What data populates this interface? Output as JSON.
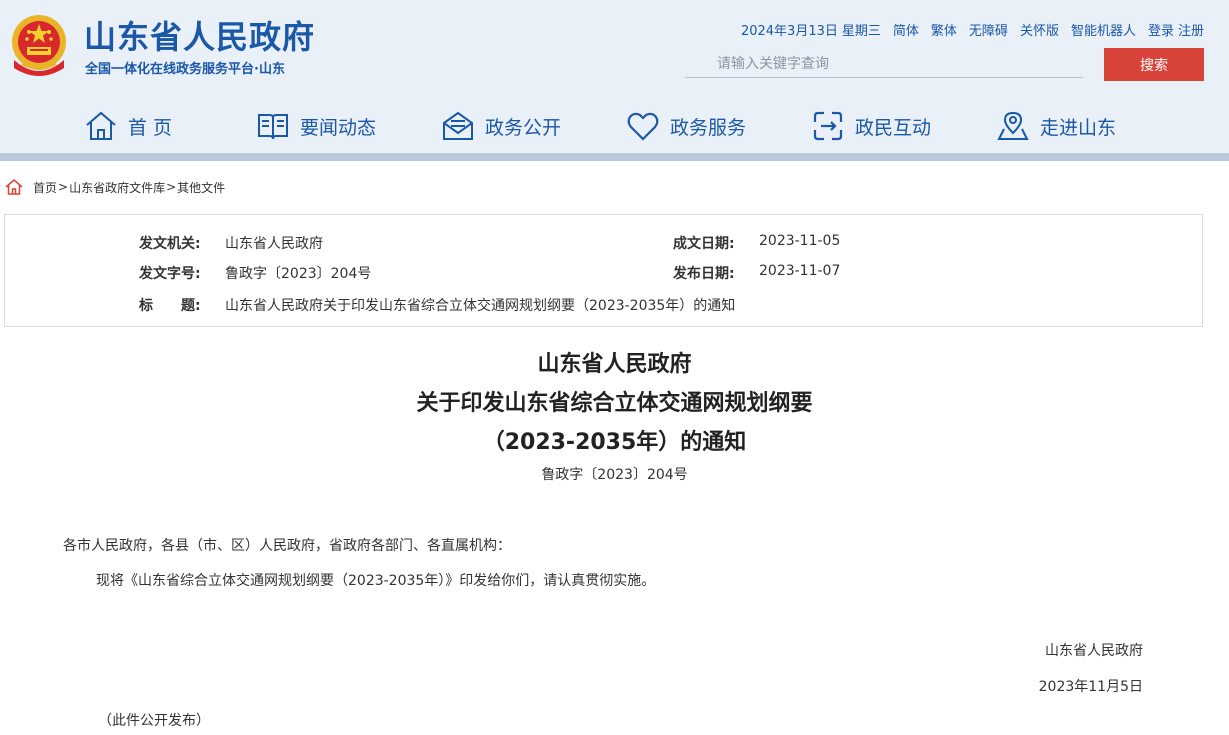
{
  "header": {
    "site_title": "山东省人民政府",
    "site_subtitle": "全国一体化在线政务服务平台·山东",
    "date": "2024年3月13日",
    "weekday": "星期三",
    "links": {
      "simplified": "简体",
      "traditional": "繁体",
      "accessible": "无障碍",
      "care_version": "关怀版",
      "robot": "智能机器人",
      "login": "登录",
      "register": "注册"
    },
    "search": {
      "placeholder": "请输入关键字查询",
      "button": "搜索"
    }
  },
  "nav": {
    "items": [
      {
        "label": "首 页",
        "icon": "home-icon"
      },
      {
        "label": "要闻动态",
        "icon": "book-icon"
      },
      {
        "label": "政务公开",
        "icon": "mail-icon"
      },
      {
        "label": "政务服务",
        "icon": "heart-icon"
      },
      {
        "label": "政民互动",
        "icon": "interaction-icon"
      },
      {
        "label": "走进山东",
        "icon": "map-pin-icon"
      }
    ]
  },
  "breadcrumb": {
    "items": [
      "首页",
      "山东省政府文件库",
      "其他文件"
    ],
    "separator": ">"
  },
  "info": {
    "issuer_label": "发文机关:",
    "issuer": "山东省人民政府",
    "created_label": "成文日期:",
    "created": "2023-11-05",
    "doc_no_label": "发文字号:",
    "doc_no": "鲁政字〔2023〕204号",
    "published_label": "发布日期:",
    "published": "2023-11-07",
    "title_label": "标　　题:",
    "title": "山东省人民政府关于印发山东省综合立体交通网规划纲要（2023-2035年）的通知"
  },
  "document": {
    "title_line1": "山东省人民政府",
    "title_line2": "关于印发山东省综合立体交通网规划纲要",
    "title_line3": "（2023-2035年）的通知",
    "number": "鲁政字〔2023〕204号",
    "salutation": "各市人民政府，各县（市、区）人民政府，省政府各部门、各直属机构：",
    "paragraph": "现将《山东省综合立体交通网规划纲要（2023-2035年）》印发给你们，请认真贯彻实施。",
    "signature": "山东省人民政府",
    "sign_date": "2023年11月5日",
    "note": "（此件公开发布）"
  },
  "colors": {
    "brand_blue": "#1a58a8",
    "header_bg": "#eaf0f8",
    "search_red": "#d9443a"
  }
}
